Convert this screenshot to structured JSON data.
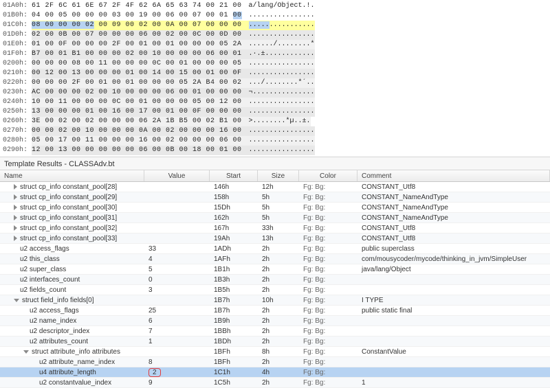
{
  "hex": {
    "rows": [
      {
        "addr": "01A0h:",
        "bytes": "61 2F 6C 61 6E 67 2F 4F 62 6A 65 63 74 00 21 00",
        "ascii": "a/lang/Object.!.",
        "cls": ""
      },
      {
        "addr": "01B0h:",
        "bytes": "04 00 05 00 00 00 03 00 19 00 06 00 07 00 01 00",
        "ascii": "................",
        "sel": "01B0"
      },
      {
        "addr": "01C0h:",
        "bytes": "08 00 00 00 02 00 09 00 02 00 0A 00 07 00 00 00",
        "ascii": "................",
        "cls": "hl-yellow",
        "sel": "01C0"
      },
      {
        "addr": "01D0h:",
        "bytes": "02 00 0B 00 07 00 00 00 06 00 02 00 0C 00 0D 00",
        "ascii": "................",
        "cls": "hl-gray2"
      },
      {
        "addr": "01E0h:",
        "bytes": "01 00 0F 00 00 00 2F 00 01 00 01 00 00 00 05 2A",
        "ascii": "....../........*",
        "cls": "hl-gray1"
      },
      {
        "addr": "01F0h:",
        "bytes": "B7 00 01 B1 00 00 00 02 00 10 00 00 00 06 00 01",
        "ascii": ".·.±............",
        "cls": "hl-gray2"
      },
      {
        "addr": "0200h:",
        "bytes": "00 00 00 08 00 11 00 00 00 0C 00 01 00 00 00 05",
        "ascii": "................",
        "cls": "hl-gray1"
      },
      {
        "addr": "0210h:",
        "bytes": "00 12 00 13 00 00 00 01 00 14 00 15 00 01 00 0F",
        "ascii": "................",
        "cls": "hl-gray2"
      },
      {
        "addr": "0220h:",
        "bytes": "00 00 00 2F 00 01 00 01 00 00 00 05 2A B4 00 02",
        "ascii": ".../........*´..",
        "cls": "hl-gray1"
      },
      {
        "addr": "0230h:",
        "bytes": "AC 00 00 00 02 00 10 00 00 00 06 00 01 00 00 00",
        "ascii": "¬...............",
        "cls": "hl-gray2"
      },
      {
        "addr": "0240h:",
        "bytes": "10 00 11 00 00 00 0C 00 01 00 00 00 05 00 12 00",
        "ascii": "................",
        "cls": "hl-gray1"
      },
      {
        "addr": "0250h:",
        "bytes": "13 00 00 00 01 00 16 00 17 00 01 00 0F 00 00 00",
        "ascii": "................",
        "cls": "hl-gray2"
      },
      {
        "addr": "0260h:",
        "bytes": "3E 00 02 00 02 00 00 00 06 2A 1B B5 00 02 B1 00",
        "ascii": ">........*µ..±.",
        "cls": "hl-gray1"
      },
      {
        "addr": "0270h:",
        "bytes": "00 00 02 00 10 00 00 00 0A 00 02 00 00 00 16 00",
        "ascii": "................",
        "cls": "hl-gray2"
      },
      {
        "addr": "0280h:",
        "bytes": "05 00 17 00 11 00 00 00 16 00 02 00 00 00 06 00",
        "ascii": "................",
        "cls": "hl-gray1"
      },
      {
        "addr": "0290h:",
        "bytes": "12 00 13 00 00 00 00 00 06 00 0B 00 18 00 01 00",
        "ascii": "................",
        "cls": "hl-gray2"
      }
    ]
  },
  "results": {
    "title": "Template Results - CLASSAdv.bt",
    "headers": {
      "name": "Name",
      "value": "Value",
      "start": "Start",
      "size": "Size",
      "color": "Color",
      "comment": "Comment"
    },
    "rows": [
      {
        "tri": "right",
        "indent": 1,
        "name": "struct cp_info constant_pool[28]",
        "value": "",
        "start": "146h",
        "size": "12h",
        "comment": "CONSTANT_Utf8"
      },
      {
        "tri": "right",
        "indent": 1,
        "name": "struct cp_info constant_pool[29]",
        "value": "",
        "start": "158h",
        "size": "5h",
        "comment": "CONSTANT_NameAndType"
      },
      {
        "tri": "right",
        "indent": 1,
        "name": "struct cp_info constant_pool[30]",
        "value": "",
        "start": "15Dh",
        "size": "5h",
        "comment": "CONSTANT_NameAndType"
      },
      {
        "tri": "right",
        "indent": 1,
        "name": "struct cp_info constant_pool[31]",
        "value": "",
        "start": "162h",
        "size": "5h",
        "comment": "CONSTANT_NameAndType"
      },
      {
        "tri": "right",
        "indent": 1,
        "name": "struct cp_info constant_pool[32]",
        "value": "",
        "start": "167h",
        "size": "33h",
        "comment": "CONSTANT_Utf8"
      },
      {
        "tri": "right",
        "indent": 1,
        "name": "struct cp_info constant_pool[33]",
        "value": "",
        "start": "19Ah",
        "size": "13h",
        "comment": "CONSTANT_Utf8"
      },
      {
        "tri": "",
        "indent": 1,
        "name": "u2 access_flags",
        "value": "33",
        "start": "1ADh",
        "size": "2h",
        "comment": "public superclass"
      },
      {
        "tri": "",
        "indent": 1,
        "name": "u2 this_class",
        "value": "4",
        "start": "1AFh",
        "size": "2h",
        "comment": "com/mousycoder/mycode/thinking_in_jvm/SimpleUser"
      },
      {
        "tri": "",
        "indent": 1,
        "name": "u2 super_class",
        "value": "5",
        "start": "1B1h",
        "size": "2h",
        "comment": "java/lang/Object"
      },
      {
        "tri": "",
        "indent": 1,
        "name": "u2 interfaces_count",
        "value": "0",
        "start": "1B3h",
        "size": "2h",
        "comment": ""
      },
      {
        "tri": "",
        "indent": 1,
        "name": "u2 fields_count",
        "value": "3",
        "start": "1B5h",
        "size": "2h",
        "comment": ""
      },
      {
        "tri": "down",
        "indent": 1,
        "name": "struct field_info fields[0]",
        "value": "",
        "start": "1B7h",
        "size": "10h",
        "comment": "I TYPE"
      },
      {
        "tri": "",
        "indent": 2,
        "name": "u2 access_flags",
        "value": "25",
        "start": "1B7h",
        "size": "2h",
        "comment": "public static final"
      },
      {
        "tri": "",
        "indent": 2,
        "name": "u2 name_index",
        "value": "6",
        "start": "1B9h",
        "size": "2h",
        "comment": ""
      },
      {
        "tri": "",
        "indent": 2,
        "name": "u2 descriptor_index",
        "value": "7",
        "start": "1BBh",
        "size": "2h",
        "comment": ""
      },
      {
        "tri": "",
        "indent": 2,
        "name": "u2 attributes_count",
        "value": "1",
        "start": "1BDh",
        "size": "2h",
        "comment": ""
      },
      {
        "tri": "down",
        "indent": 2,
        "name": "struct attribute_info attributes",
        "value": "",
        "start": "1BFh",
        "size": "8h",
        "comment": "ConstantValue"
      },
      {
        "tri": "",
        "indent": 3,
        "name": "u2 attribute_name_index",
        "value": "8",
        "start": "1BFh",
        "size": "2h",
        "comment": ""
      },
      {
        "tri": "",
        "indent": 3,
        "name": "u4 attribute_length",
        "value": "2",
        "start": "1C1h",
        "size": "4h",
        "comment": "",
        "selected": true,
        "boxed": true
      },
      {
        "tri": "",
        "indent": 3,
        "name": "u2 constantvalue_index",
        "value": "9",
        "start": "1C5h",
        "size": "2h",
        "comment": "1"
      }
    ],
    "fgbg": "Fg:    Bg:"
  }
}
